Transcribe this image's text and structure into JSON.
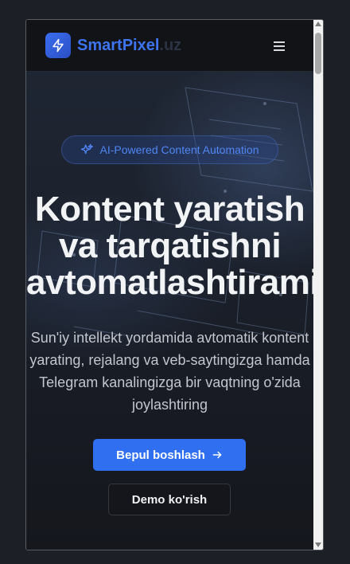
{
  "navbar": {
    "brand_main": "SmartPixel",
    "brand_tld": ".uz",
    "logo_icon": "lightning-bolt-icon",
    "menu_icon": "hamburger-menu-icon"
  },
  "hero": {
    "badge_icon": "sparkles-icon",
    "badge_text": "AI-Powered Content Automation",
    "headline_lines": [
      "Kontent yaratish",
      "va tarqatishni",
      "avtomatlashtiramiz"
    ],
    "subtext_lines": [
      "Sun'iy intellekt yordamida avtomatik kontent",
      "yarating, rejalang va veb-saytingizga hamda",
      "Telegram kanalingizga bir vaqtning o'zida",
      "joylashtiring"
    ],
    "primary_button": "Bepul boshlash",
    "primary_button_icon": "arrow-right-icon",
    "secondary_button": "Demo ko'rish"
  },
  "colors": {
    "accent": "#2f6ff0",
    "brand": "#3e74f0",
    "background": "#121419"
  }
}
